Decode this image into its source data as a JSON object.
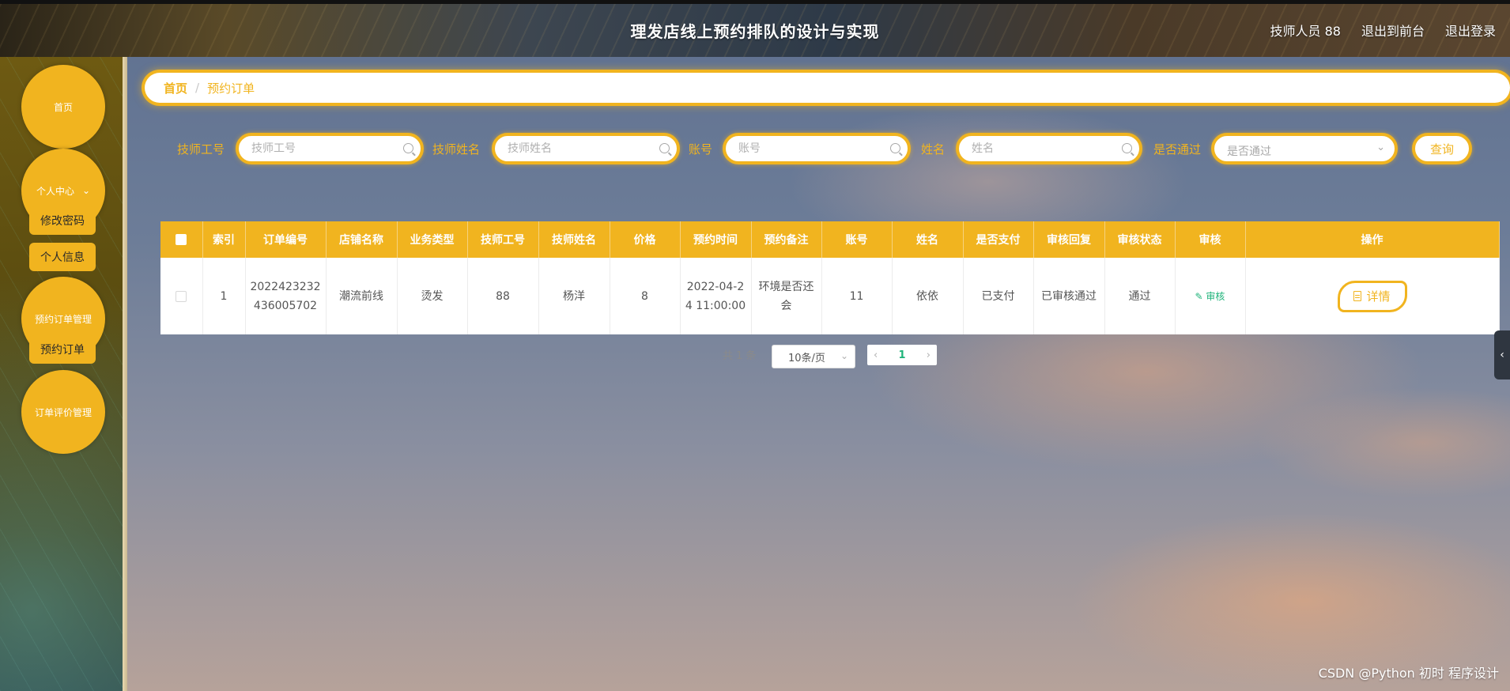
{
  "header": {
    "title": "理发店线上预约排队的设计与实现",
    "user_label": "技师人员 88",
    "front_link": "退出到前台",
    "logout_link": "退出登录"
  },
  "sidebar": {
    "home": "首页",
    "personal_center": "个人中心",
    "change_password": "修改密码",
    "personal_info": "个人信息",
    "order_mgmt": "预约订单管理",
    "orders": "预约订单",
    "review_mgmt": "订单评价管理"
  },
  "breadcrumb": {
    "home": "首页",
    "sep": "/",
    "current": "预约订单"
  },
  "search": {
    "f1_label": "技师工号",
    "f1_placeholder": "技师工号",
    "f2_label": "技师姓名",
    "f2_placeholder": "技师姓名",
    "f3_label": "账号",
    "f3_placeholder": "账号",
    "f4_label": "姓名",
    "f4_placeholder": "姓名",
    "f5_label": "是否通过",
    "f5_value": "是否通过",
    "query": "查询"
  },
  "table": {
    "headers": [
      "索引",
      "订单编号",
      "店铺名称",
      "业务类型",
      "技师工号",
      "技师姓名",
      "价格",
      "预约时间",
      "预约备注",
      "账号",
      "姓名",
      "是否支付",
      "审核回复",
      "审核状态",
      "审核",
      "操作"
    ],
    "rows": [
      {
        "index": "1",
        "order_no": "2022423232436005702",
        "shop": "潮流前线",
        "biz_type": "烫发",
        "tech_id": "88",
        "tech_name": "杨洋",
        "price": "8",
        "time": "2022-04-24 11:00:00",
        "remark": "环境是否还会",
        "account": "11",
        "name": "依依",
        "paid": "已支付",
        "reply": "已审核通过",
        "status": "通过",
        "review": "审核",
        "detail": "详情"
      }
    ]
  },
  "pagination": {
    "total": "共 1 条",
    "page_size": "10条/页",
    "current": "1"
  },
  "watermark": "CSDN @Python 初时 程序设计",
  "colors": {
    "accent": "#f1b41f",
    "link_green": "#1fb37a"
  }
}
